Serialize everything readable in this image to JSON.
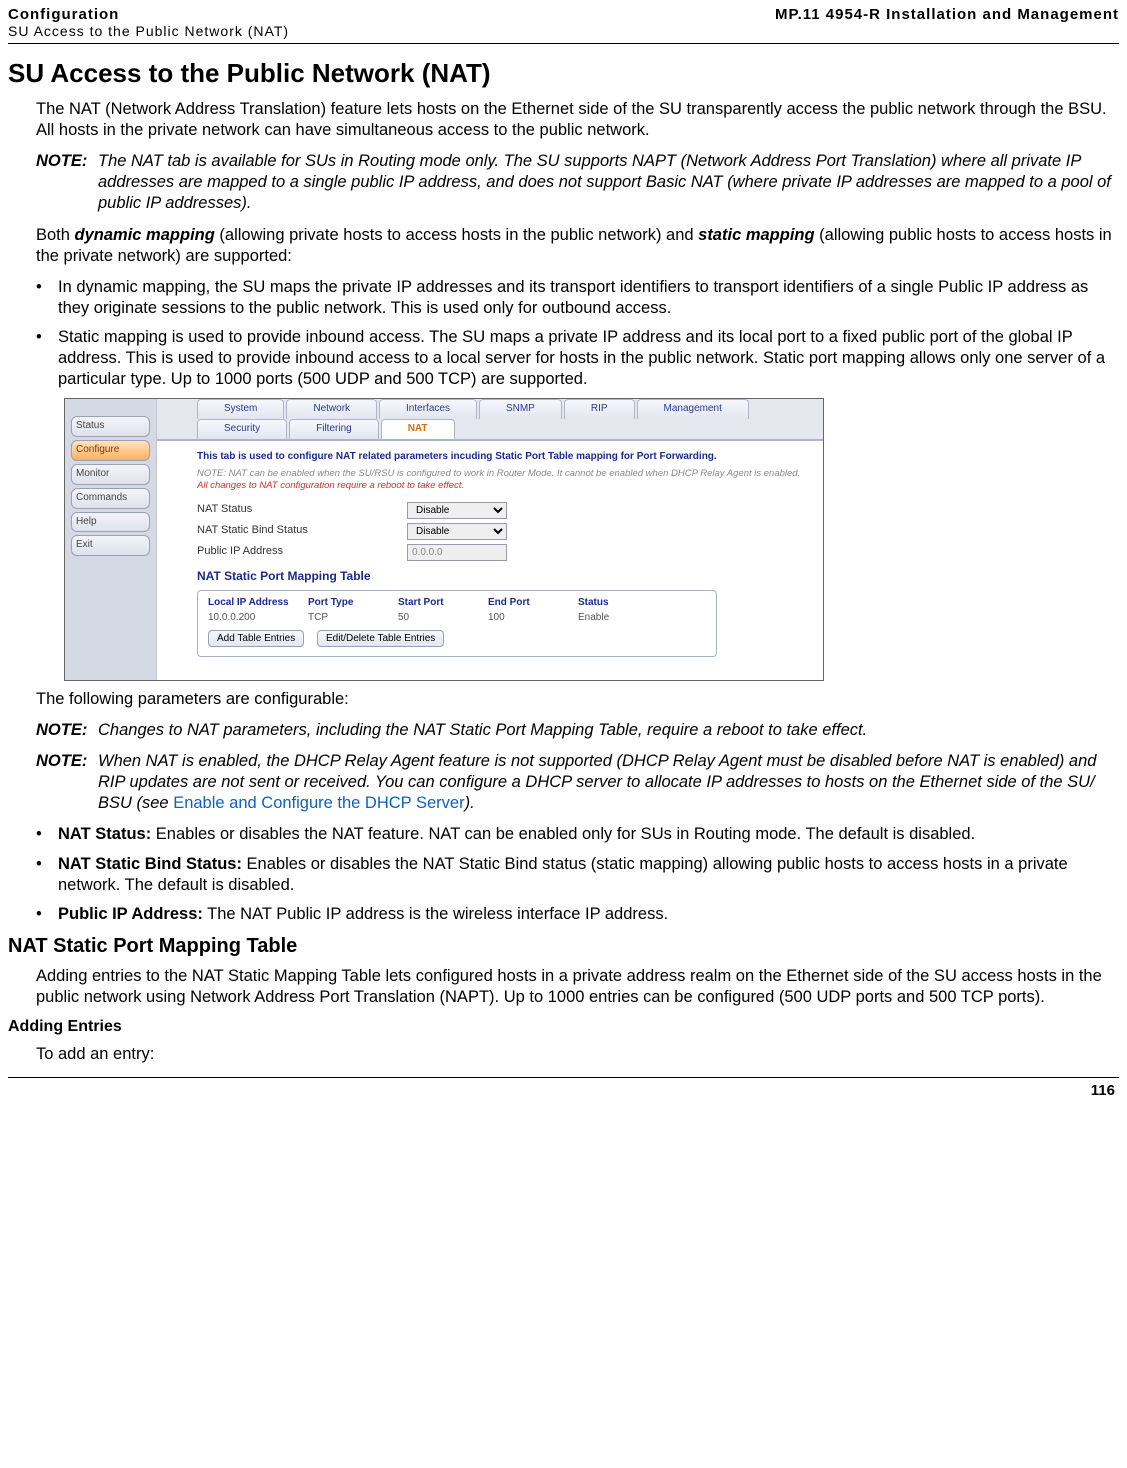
{
  "header": {
    "left_line1": "Configuration",
    "left_line2": "SU Access to the Public Network (NAT)",
    "right": "MP.11 4954-R Installation and Management"
  },
  "title": "SU Access to the Public Network (NAT)",
  "para_intro": "The NAT (Network Address Translation) feature lets hosts on the Ethernet side of the SU transparently access the public network through the BSU. All hosts in the private network can have simultaneous access to the public network.",
  "note1_label": "NOTE:",
  "note1_body": "The NAT tab is available for SUs in Routing mode only. The SU supports NAPT (Network Address Port Translation) where all private IP addresses are mapped to a single public IP address, and does not support Basic NAT (where private IP addresses are mapped to a pool of public IP addresses).",
  "para_both_pre": "Both ",
  "para_both_dyn": "dynamic mapping",
  "para_both_mid": " (allowing private hosts to access hosts in the public network) and ",
  "para_both_stat": "static mapping",
  "para_both_post": " (allowing public hosts to access hosts in the private network) are supported:",
  "bullet1": "In dynamic mapping, the SU maps the private IP addresses and its transport identifiers to transport identifiers of a single Public IP address as they originate sessions to the public network. This is used only for outbound access.",
  "bullet2": "Static mapping is used to provide inbound access. The SU maps a private IP address and its local port to a fixed public port of the global IP address. This is used to provide inbound access to a local server for hosts in the public network. Static port mapping allows only one server of a particular type. Up to 1000 ports (500 UDP and 500 TCP) are supported.",
  "embed": {
    "sidebar": [
      "Status",
      "Configure",
      "Monitor",
      "Commands",
      "Help",
      "Exit"
    ],
    "tabs_row1": [
      "System",
      "Network",
      "Interfaces",
      "SNMP",
      "RIP",
      "Management"
    ],
    "tabs_row2": [
      "Security",
      "Filtering",
      "NAT"
    ],
    "intro": "This tab is used to configure NAT related parameters incuding Static Port Table mapping for Port Forwarding.",
    "subintro_plain": "NOTE: NAT can be enabled when the SU/RSU is configured to work in Router Mode. It cannot be enabled when DHCP Relay Agent is enabled. ",
    "subintro_red": "All changes to NAT configuration require a reboot to take effect.",
    "fields": {
      "nat_status_label": "NAT Status",
      "nat_status_value": "Disable",
      "nat_bind_label": "NAT Static Bind Status",
      "nat_bind_value": "Disable",
      "public_ip_label": "Public IP Address",
      "public_ip_value": "0.0.0.0"
    },
    "section_title": "NAT Static Port Mapping Table",
    "table": {
      "headers": [
        "Local IP Address",
        "Port Type",
        "Start Port",
        "End Port",
        "Status"
      ],
      "row": [
        "10.0.0.200",
        "TCP",
        "50",
        "100",
        "Enable"
      ],
      "btn_add": "Add Table Entries",
      "btn_edit": "Edit/Delete Table Entries"
    }
  },
  "para_following": "The following parameters are configurable:",
  "note2_label": "NOTE:",
  "note2_body": "Changes to NAT parameters, including the NAT Static Port Mapping Table, require a reboot to take effect.",
  "note3_label": "NOTE:",
  "note3_body_pre": "When NAT is enabled, the DHCP Relay Agent feature is not supported (DHCP Relay Agent must be disabled before NAT is enabled) and RIP updates are not sent or received. You can configure a DHCP server to allocate IP addresses to hosts on the Ethernet side of the SU/ BSU (see ",
  "note3_link": "Enable and Configure the DHCP Server",
  "note3_body_post": ").",
  "param1_label": "NAT Status:",
  "param1_body": " Enables or disables the NAT feature. NAT can be enabled only for SUs in Routing mode. The default is disabled.",
  "param2_label": "NAT Static Bind Status:",
  "param2_body": " Enables or disables the NAT Static Bind status (static mapping) allowing public hosts to access hosts in a private network. The default is disabled.",
  "param3_label": "Public IP Address:",
  "param3_body": " The NAT Public IP address is the wireless interface IP address.",
  "h2": "NAT Static Port Mapping Table",
  "h2_para": "Adding entries to the NAT Static Mapping Table lets configured hosts in a private address realm on the Ethernet side of the SU access hosts in the public network using Network Address Port Translation (NAPT). Up to 1000 entries can be configured (500 UDP ports and 500 TCP ports).",
  "h3": "Adding Entries",
  "h3_para": "To add an entry:",
  "page_number": "116"
}
